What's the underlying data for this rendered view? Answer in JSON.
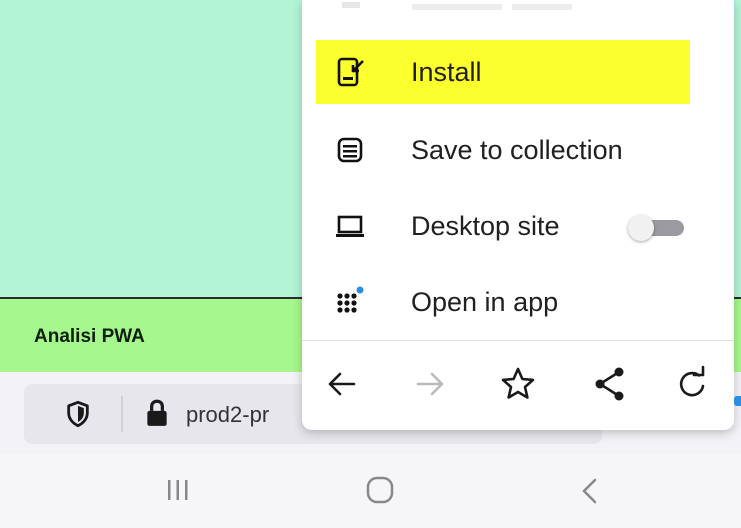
{
  "page": {
    "header_title": "Analisi PWA",
    "colors": {
      "mint_bg": "#b3f3d6",
      "header_bg": "#a6f78d",
      "highlight": "#fbff2e",
      "accent_dot": "#2d8de0"
    }
  },
  "urlbar": {
    "url_text": "prod2-pr",
    "icons": {
      "shield": "shield-icon",
      "lock": "lock-icon"
    }
  },
  "menu": {
    "items": [
      {
        "label": "Install",
        "icon": "install-app-icon",
        "highlighted": true
      },
      {
        "label": "Save to collection",
        "icon": "collection-icon",
        "highlighted": false
      },
      {
        "label": "Desktop site",
        "icon": "laptop-icon",
        "highlighted": false,
        "toggle_on": false
      },
      {
        "label": "Open in app",
        "icon": "grid-app-icon",
        "highlighted": false,
        "has_badge": true
      }
    ],
    "nav_icons": [
      "back-arrow-icon",
      "forward-arrow-icon",
      "star-icon",
      "share-icon",
      "reload-icon"
    ]
  },
  "system_nav": {
    "icons": [
      "recents-icon",
      "home-icon",
      "back-chevron-icon"
    ]
  }
}
